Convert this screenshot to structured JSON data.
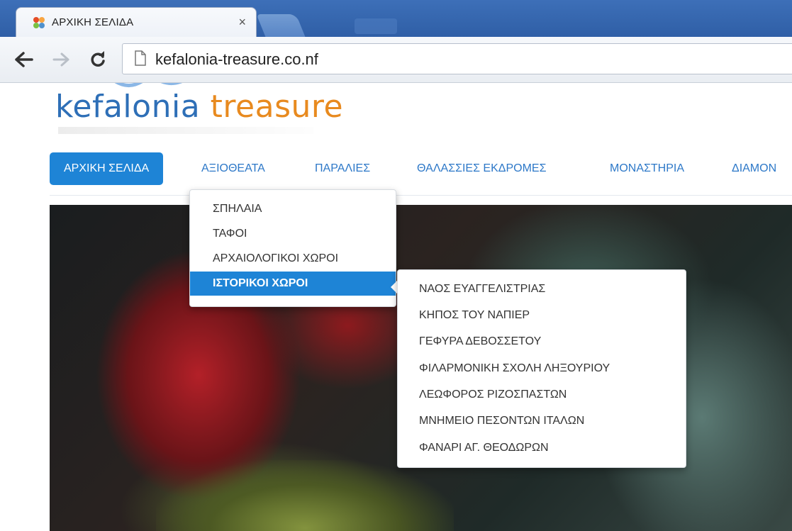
{
  "browser": {
    "tab_title": "ΑΡΧΙΚΗ ΣΕΛΙΔΑ",
    "tab_close": "×",
    "url": "kefalonia-treasure.co.nf"
  },
  "logo": {
    "word1": "kefalonia",
    "word2": "treasure"
  },
  "menu": {
    "items": [
      "ΑΡΧΙΚΗ ΣΕΛΙΔΑ",
      "ΑΞΙΟΘΕΑΤΑ",
      "ΠΑΡΑΛΙΕΣ",
      "ΘΑΛΑΣΣΙΕΣ ΕΚΔΡΟΜΕΣ",
      "ΜΟΝΑΣΤΗΡΙΑ",
      "ΔΙΑΜΟΝ"
    ]
  },
  "submenu": {
    "items": [
      "ΣΠΗΛΑΙΑ",
      "ΤΑΦΟΙ",
      "ΑΡΧΑΙΟΛΟΓΙΚΟΙ ΧΩΡΟΙ",
      "ΙΣΤΟΡΙΚΟΙ ΧΩΡΟΙ"
    ]
  },
  "subsubmenu": {
    "items": [
      "ΝΑΟΣ ΕΥΑΓΓΕΛΙΣΤΡΙΑΣ",
      "ΚΗΠΟΣ ΤΟΥ ΝΑΠΙΕΡ",
      "ΓΕΦΥΡΑ ΔΕΒΟΣΣΕΤΟΥ",
      "ΦΙΛΑΡΜΟΝΙΚΗ ΣΧΟΛΗ ΛΗΞΟΥΡΙΟΥ",
      "ΛΕΩΦΟΡΟΣ ΡΙΖΟΣΠΑΣΤΩΝ",
      "ΜΝΗΜΕΙΟ ΠΕΣΟΝΤΩΝ ΙΤΑΛΩΝ",
      "ΦΑΝΑΡΙ ΑΓ. ΘΕΟΔΩΡΩΝ"
    ]
  },
  "colors": {
    "accent": "#1e84d6",
    "link": "#2d78c8",
    "logo_blue": "#2e6fb7",
    "logo_orange": "#e88a1f"
  }
}
